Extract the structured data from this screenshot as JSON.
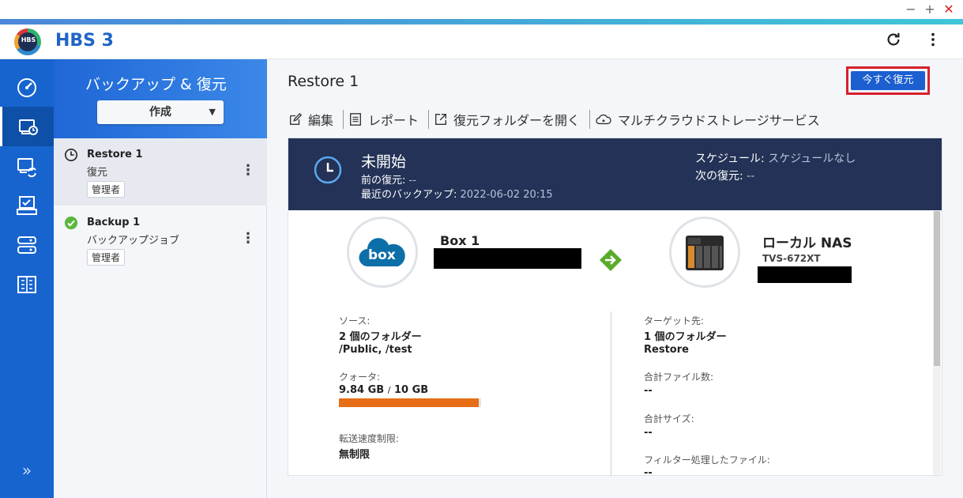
{
  "window": {
    "min_label": "−",
    "max_label": "+",
    "close_label": "✕"
  },
  "app": {
    "logo_text": "HBS",
    "title": "HBS 3"
  },
  "rail": {
    "items": [
      {
        "name": "dashboard-icon"
      },
      {
        "name": "restore-icon",
        "active": true
      },
      {
        "name": "sync-icon"
      },
      {
        "name": "services-icon"
      },
      {
        "name": "storage-icon"
      },
      {
        "name": "logs-icon"
      }
    ],
    "expand_label": "»"
  },
  "jobs_panel": {
    "title": "バックアップ & 復元",
    "create_label": "作成",
    "create_caret": "▼",
    "jobs": [
      {
        "name": "Restore 1",
        "type": "復元",
        "badge": "管理者",
        "status": "clock",
        "menu": "⋮"
      },
      {
        "name": "Backup 1",
        "type": "バックアップジョブ",
        "badge": "管理者",
        "status": "check",
        "menu": "⋮"
      }
    ]
  },
  "main": {
    "title": "Restore 1",
    "restore_now": "今すぐ復元",
    "toolbar": {
      "edit": "編集",
      "report": "レポート",
      "open_folder": "復元フォルダーを開く",
      "multicloud": "マルチクラウドストレージサービス"
    },
    "status": {
      "title": "未開始",
      "prev_label": "前の復元:",
      "prev_value": "--",
      "last_backup_label": "最近のバックアップ:",
      "last_backup_value": "2022-06-02 20:15",
      "schedule_label": "スケジュール:",
      "schedule_value": "スケジュールなし",
      "next_label": "次の復元:",
      "next_value": "--"
    },
    "source": {
      "name": "Box 1",
      "logo_text": "box",
      "label": "ソース:",
      "folders": "2 個のフォルダー",
      "paths": "/Public, /test",
      "quota_label": "クォータ:",
      "quota_used": "9.84 GB",
      "quota_sep": "/",
      "quota_total": "10 GB",
      "quota_fraction": 0.984,
      "quota_color": "#e76d16",
      "speed_label": "転送速度制限:",
      "speed_value": "無制限"
    },
    "target": {
      "name": "ローカル NAS",
      "model": "TVS-672XT",
      "label": "ターゲット先:",
      "folders": "1 個のフォルダー",
      "folder_name": "Restore",
      "total_files_label": "合計ファイル数:",
      "total_files_value": "--",
      "total_size_label": "合計サイズ:",
      "total_size_value": "--",
      "filtered_label": "フィルター処理したファイル:",
      "filtered_value": "--"
    }
  }
}
